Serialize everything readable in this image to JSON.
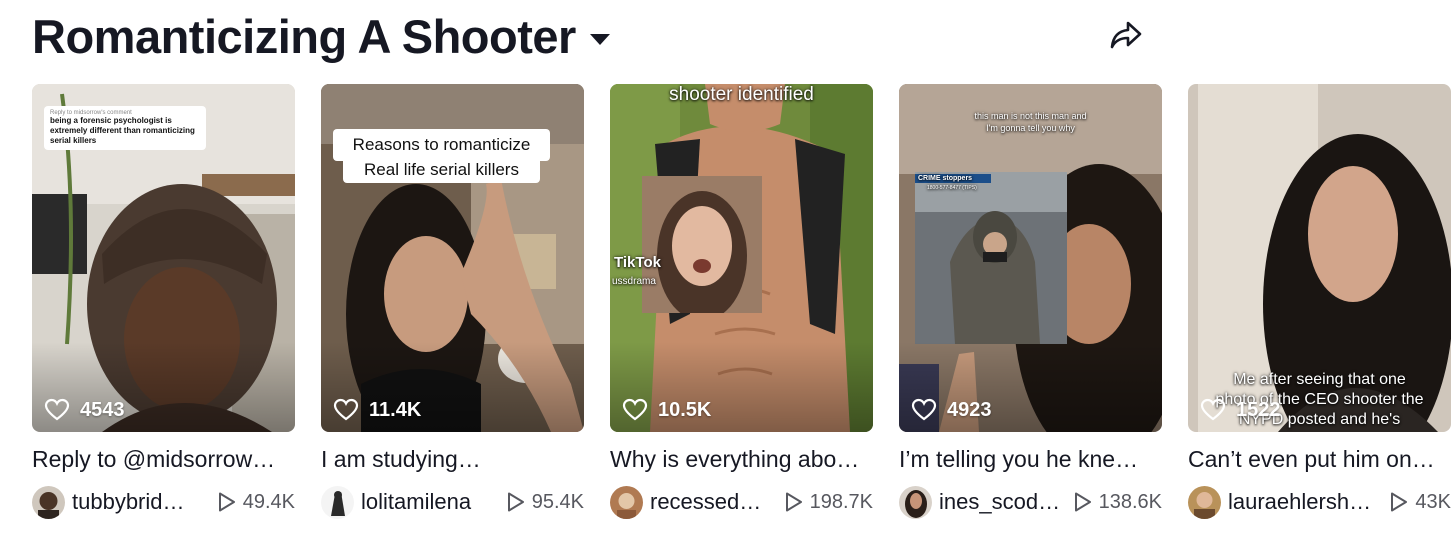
{
  "header": {
    "title": "Romanticizing A Shooter"
  },
  "icons": {
    "share": "share-arrow-icon",
    "dropdown": "chevron-down-icon",
    "like": "heart-outline-icon",
    "play": "play-triangle-icon"
  },
  "videos": [
    {
      "likes": "4543",
      "description": "Reply to @midsorrow…",
      "username": "tubbybrid…",
      "views": "49.4K",
      "overlay": {
        "reply_header": "Reply to midsorrow's comment",
        "comment": "being a forensic psychologist is extremely different than romanticizing serial killers"
      }
    },
    {
      "likes": "11.4K",
      "description": "I am studying…",
      "username": "lolitamilena",
      "views": "95.4K",
      "overlay": {
        "line1": "Reasons to romanticize",
        "line2": "Real life serial killers"
      }
    },
    {
      "likes": "10.5K",
      "description": "Why is everything abo…",
      "username": "recessed…",
      "views": "198.7K",
      "overlay": {
        "caption": "shooter identified",
        "watermark": "TikTok",
        "watermark_user": "ussdrama"
      }
    },
    {
      "likes": "4923",
      "description": "I’m telling you he kne…",
      "username": "ines_scod…",
      "views": "138.6K",
      "overlay": {
        "line1": "this man is not this man and",
        "line2": "I'm gonna tell you why",
        "badge": "CRIME stoppers",
        "badge_phone": "1800-577-8477 (TIPS)"
      }
    },
    {
      "likes": "1522",
      "description": "Can’t even put him on…",
      "username": "lauraehlersh…",
      "views": "43K",
      "overlay": {
        "line1": "Me after seeing that one",
        "line2": "photo of the CEO shooter the",
        "line3": "NYPD posted and he's"
      }
    }
  ],
  "colors": {
    "text": "#161823",
    "muted": "#57585f",
    "background": "#ffffff"
  }
}
